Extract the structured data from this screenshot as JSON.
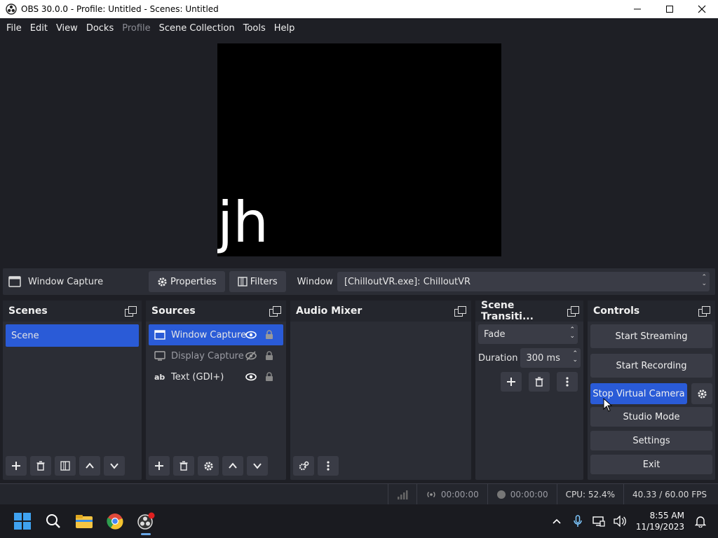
{
  "window": {
    "title": "OBS 30.0.0 - Profile: Untitled - Scenes: Untitled",
    "minimize": "—",
    "maximize": "☐",
    "close": "✕"
  },
  "menu": [
    "File",
    "Edit",
    "View",
    "Docks",
    "Profile",
    "Scene Collection",
    "Tools",
    "Help"
  ],
  "preview": {
    "text": "jh"
  },
  "source_toolbar": {
    "source_name": "Window Capture",
    "properties_label": "Properties",
    "filters_label": "Filters",
    "window_label": "Window",
    "window_value": "[ChilloutVR.exe]: ChilloutVR"
  },
  "scenes": {
    "title": "Scenes",
    "items": [
      "Scene"
    ]
  },
  "sources": {
    "title": "Sources",
    "items": [
      {
        "name": "Window Capture",
        "icon": "window-icon",
        "visible": true
      },
      {
        "name": "Display Capture",
        "icon": "monitor-icon",
        "visible": false
      },
      {
        "name": "Text (GDI+)",
        "icon": "text-icon",
        "visible": true
      }
    ]
  },
  "audio_mixer": {
    "title": "Audio Mixer"
  },
  "transitions": {
    "title": "Scene Transiti...",
    "selected": "Fade",
    "duration_label": "Duration",
    "duration_value": "300 ms"
  },
  "controls": {
    "title": "Controls",
    "start_streaming": "Start Streaming",
    "start_recording": "Start Recording",
    "virtual_camera": "Stop Virtual Camera",
    "studio_mode": "Studio Mode",
    "settings": "Settings",
    "exit": "Exit"
  },
  "status": {
    "stream_time": "00:00:00",
    "record_time": "00:00:00",
    "cpu": "CPU: 52.4%",
    "fps": "40.33 / 60.00 FPS"
  },
  "taskbar": {
    "time": "8:55 AM",
    "date": "11/19/2023"
  },
  "colors": {
    "accent": "#2a5bd7",
    "background": "#1e1f25",
    "panel": "#2b2d35"
  }
}
